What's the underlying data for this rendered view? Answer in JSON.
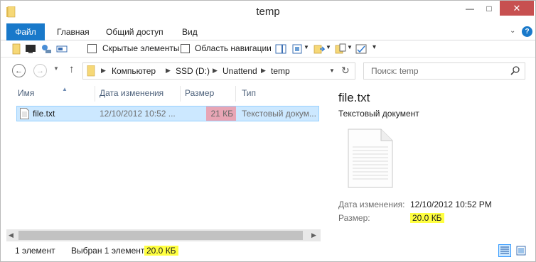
{
  "window": {
    "title": "temp"
  },
  "ribbon": {
    "tabs": [
      "Файл",
      "Главная",
      "Общий доступ",
      "Вид"
    ],
    "hidden_items_label": "Скрытые элементы",
    "nav_pane_label": "Область навигации"
  },
  "address": {
    "crumbs": [
      "Компьютер",
      "SSD (D:)",
      "Unattend",
      "temp"
    ],
    "search_placeholder": "Поиск: temp"
  },
  "list": {
    "columns": [
      "Имя",
      "Дата изменения",
      "Размер",
      "Тип"
    ],
    "rows": [
      {
        "name": "file.txt",
        "date": "12/10/2012 10:52 ...",
        "size": "21 КБ",
        "type": "Текстовый докум..."
      }
    ]
  },
  "preview": {
    "file_name": "file.txt",
    "file_type": "Текстовый документ",
    "modified_label": "Дата изменения:",
    "modified_value": "12/10/2012 10:52 PM",
    "size_label": "Размер:",
    "size_value": "20.0 КБ"
  },
  "status": {
    "count": "1 элемент",
    "selected_prefix": "Выбран 1 элемент:",
    "selected_size": "20.0 КБ"
  },
  "colors": {
    "accent": "#1979ca",
    "selection": "#cce8ff",
    "size_highlight": "#e8a5b5",
    "yellow_highlight": "#ffff40"
  }
}
